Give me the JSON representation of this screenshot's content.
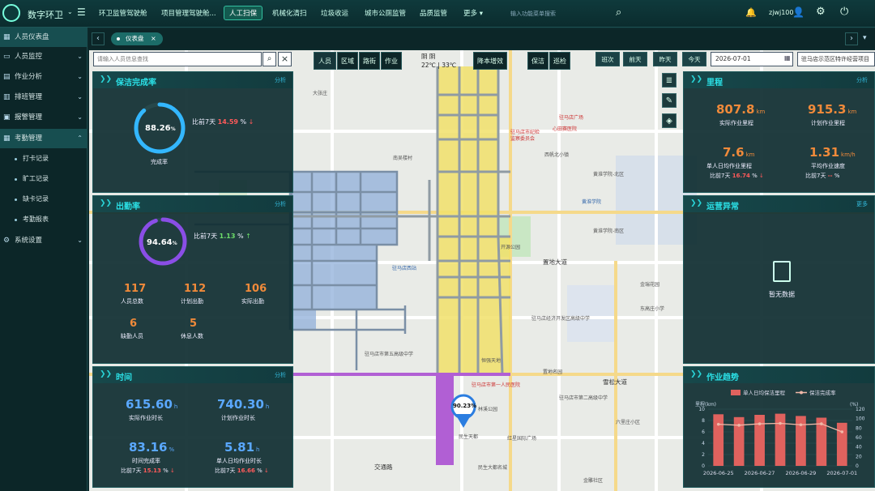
{
  "app": {
    "brand": "数字环卫",
    "search_placeholder": "输入功能菜单搜索",
    "username": "zjwj100"
  },
  "nav": [
    {
      "label": "环卫监管驾驶舱"
    },
    {
      "label": "项目管理驾驶舱..."
    },
    {
      "label": "人工扫保",
      "active": true
    },
    {
      "label": "机械化清扫"
    },
    {
      "label": "垃圾收运"
    },
    {
      "label": "城市公厕监管"
    },
    {
      "label": "品质监管"
    },
    {
      "label": "更多"
    }
  ],
  "sidebar": {
    "items": [
      {
        "label": "人员仪表盘",
        "icon": "dashboard-icon",
        "selected": true
      },
      {
        "label": "人员监控",
        "icon": "monitor-icon"
      },
      {
        "label": "作业分析",
        "icon": "chart-icon"
      },
      {
        "label": "排班管理",
        "icon": "schedule-icon"
      },
      {
        "label": "报警管理",
        "icon": "alarm-icon"
      },
      {
        "label": "考勤管理",
        "icon": "attendance-icon",
        "expanded": true
      }
    ],
    "sub_items": [
      {
        "label": "打卡记录"
      },
      {
        "label": "旷工记录"
      },
      {
        "label": "缺卡记录"
      },
      {
        "label": "考勤报表"
      }
    ],
    "system": {
      "label": "系统设置",
      "icon": "settings-icon"
    }
  },
  "tabs": {
    "active_label": "仪表盘"
  },
  "toolbar": {
    "search_placeholder": "请输入人员信息查找",
    "layer_buttons": [
      "人员",
      "区域",
      "路街",
      "作业"
    ],
    "mode_buttons": [
      "降本增效",
      "保洁",
      "巡检"
    ],
    "date_buttons": [
      "班次",
      "前天",
      "昨天",
      "今天"
    ],
    "date_value": "2026-07-01",
    "area_value": "驻马店示范区特许经营项目"
  },
  "weather": {
    "condition": "阴 阴",
    "temp": "22℃ | 33℃"
  },
  "cleaning_rate": {
    "title": "保洁完成率",
    "link": "分析",
    "value": "88.26",
    "unit": "%",
    "ratio": 0.8826,
    "caption": "完成率",
    "compare_label": "比前7天",
    "compare_value": "14.59",
    "compare_unit": "%",
    "trend": "↓"
  },
  "attendance": {
    "title": "出勤率",
    "link": "分析",
    "value": "94.64",
    "unit": "%",
    "ratio": 0.9464,
    "compare_label": "比前7天",
    "compare_value": "1.13",
    "compare_unit": "%",
    "trend": "↑",
    "stats": [
      {
        "value": "117",
        "label": "人员总数"
      },
      {
        "value": "112",
        "label": "计划出勤"
      },
      {
        "value": "106",
        "label": "实际出勤"
      },
      {
        "value": "6",
        "label": "缺勤人员"
      },
      {
        "value": "5",
        "label": "休息人数"
      }
    ]
  },
  "time": {
    "title": "时间",
    "link": "分析",
    "actual": {
      "value": "615.60",
      "unit": "h",
      "label": "实际作业时长"
    },
    "planned": {
      "value": "740.30",
      "unit": "h",
      "label": "计划作业时长"
    },
    "completion": {
      "value": "83.16",
      "unit": "%",
      "label": "时间完成率",
      "compare_label": "比前7天",
      "compare_value": "15.13",
      "compare_unit": "%",
      "trend": "↓"
    },
    "per_capita": {
      "value": "5.81",
      "unit": "h",
      "label": "单人日均作业时长",
      "compare_label": "比前7天",
      "compare_value": "16.66",
      "compare_unit": "%",
      "trend": "↓"
    }
  },
  "mileage": {
    "title": "里程",
    "link": "分析",
    "actual": {
      "value": "807.8",
      "unit": "km",
      "label": "实际作业里程"
    },
    "planned": {
      "value": "915.3",
      "unit": "km",
      "label": "计划作业里程"
    },
    "per_capita": {
      "value": "7.6",
      "unit": "km",
      "label": "单人日均作业里程",
      "compare_label": "比前7天",
      "compare_value": "16.74",
      "compare_unit": "%",
      "trend": "↓"
    },
    "speed": {
      "value": "1.31",
      "unit": "km/h",
      "label": "平均作业速度",
      "compare_label": "比前7天",
      "compare_value": "--",
      "compare_unit": "%"
    }
  },
  "anomaly": {
    "title": "运营异常",
    "link": "更多",
    "empty_text": "暂无数据"
  },
  "map": {
    "marker_value": "90.23%",
    "roads": [
      "置地大道",
      "雪松大道",
      "交通路"
    ],
    "labels": [
      {
        "text": "大张庄"
      },
      {
        "text": "南吴楼村"
      },
      {
        "text": "驻马店市纪检"
      },
      {
        "text": "监察委员会"
      },
      {
        "text": "驻马店广场"
      },
      {
        "text": "心田赛医院"
      },
      {
        "text": "西帆北小镇"
      },
      {
        "text": "驻马店市第一人民医院"
      },
      {
        "text": "驻马店市第五高级中学"
      },
      {
        "text": "驻马店经济开发区高级中学"
      },
      {
        "text": "黄淮学院"
      },
      {
        "text": "黄淮学院-北区"
      },
      {
        "text": "黄淮学院-南区"
      },
      {
        "text": "开源公园"
      },
      {
        "text": "驻马店西站"
      },
      {
        "text": "东高庄小学"
      },
      {
        "text": "金瑞花园"
      },
      {
        "text": "民生天都"
      },
      {
        "text": "红星国际广场"
      },
      {
        "text": "林溪公园"
      },
      {
        "text": "恒强天地"
      },
      {
        "text": "六里庄小区"
      },
      {
        "text": "驻马店市第二高级中学"
      },
      {
        "text": "民生大都名城"
      },
      {
        "text": "金雕社区"
      },
      {
        "text": "置地名园"
      }
    ]
  },
  "chart_data": {
    "type": "bar",
    "title": "作业趋势",
    "categories": [
      "2026-06-25",
      "2026-06-26",
      "2026-06-27",
      "2026-06-28",
      "2026-06-29",
      "2026-06-30",
      "2026-07-01"
    ],
    "xtick_labels": [
      "2026-06-25",
      "2026-06-27",
      "2026-06-29",
      "2026-07-01"
    ],
    "series": [
      {
        "name": "单人日均保洁里程",
        "type": "bar",
        "axis": "left",
        "color": "#e0625e",
        "values": [
          9.1,
          8.6,
          9.0,
          9.2,
          8.8,
          8.5,
          7.6
        ]
      },
      {
        "name": "保洁完成率",
        "type": "line",
        "axis": "right",
        "color": "#f0b8a8",
        "values": [
          88,
          86,
          89,
          90,
          87,
          89,
          72
        ]
      }
    ],
    "ylabel_left": "里程(km)",
    "ylim_left": [
      0,
      10
    ],
    "yticks_left": [
      0,
      2,
      4,
      6,
      8,
      10
    ],
    "ylabel_right": "(%)",
    "ylim_right": [
      0,
      120
    ],
    "yticks_right": [
      0,
      20,
      40,
      60,
      80,
      100,
      120
    ],
    "legend": "top-center"
  },
  "colors": {
    "accent": "#2be0e6",
    "up": "#6dde6a",
    "down": "#ff5a5a",
    "orange": "#f08a3a",
    "blue": "#5aa8ff"
  }
}
